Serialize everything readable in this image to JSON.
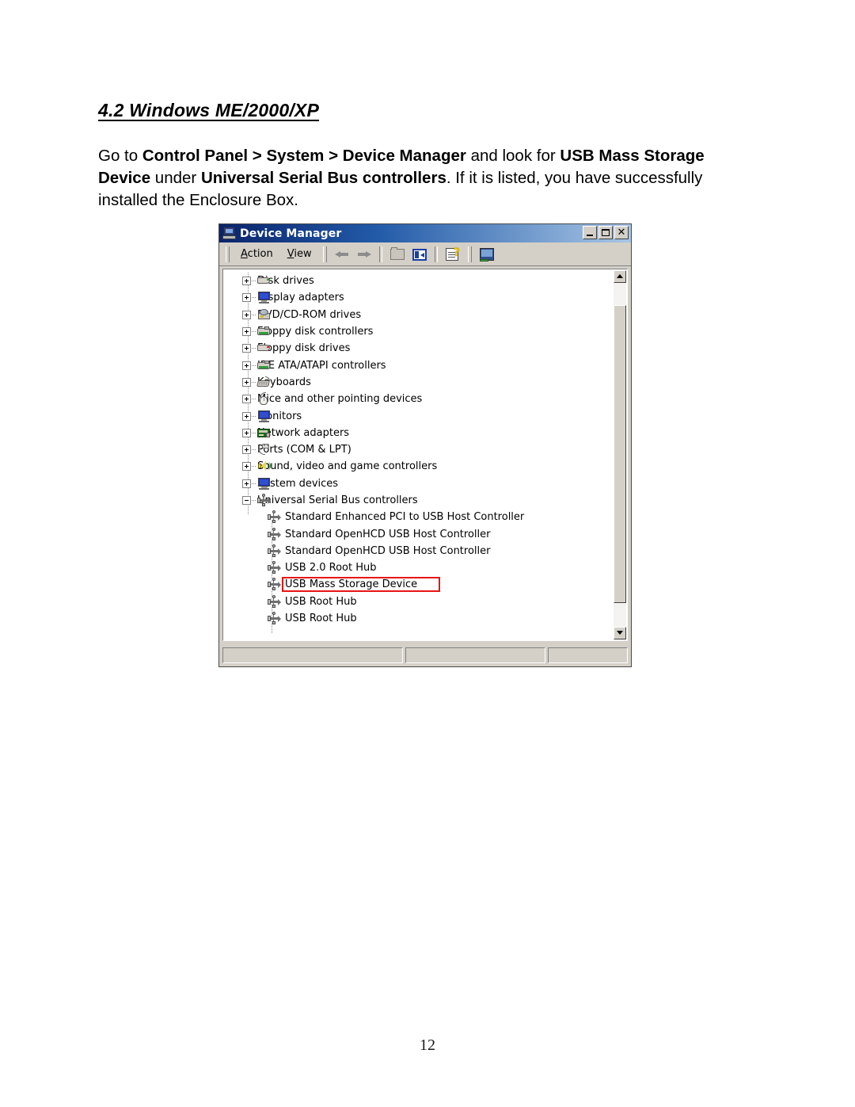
{
  "document": {
    "heading": "4.2 Windows ME/2000/XP",
    "paragraph": {
      "seg1": "Go to ",
      "b1": "Control Panel > System > Device Manager",
      "seg2": " and look for ",
      "b2": "USB Mass Storage Device",
      "seg3": " under ",
      "b3": "Universal Serial Bus controllers",
      "seg4": ". If it is listed, you have successfully installed the Enclosure Box."
    },
    "page_number": "12"
  },
  "window": {
    "title": "Device Manager",
    "title_icon": "computer-icon",
    "controls": {
      "minimize": "minimize-button",
      "maximize": "maximize-button",
      "close": "close-button"
    },
    "toolbar": {
      "menus": [
        {
          "label": "Action",
          "accel": "A"
        },
        {
          "label": "View",
          "accel": "V"
        }
      ],
      "icons": [
        "back-arrow-icon",
        "forward-arrow-icon",
        "show-hidden-devices-icon",
        "properties-icon",
        "help-icon",
        "scan-for-hardware-changes-icon"
      ]
    },
    "tree": {
      "root_items": [
        {
          "label": "Disk drives",
          "icon": "disk-drive-icon",
          "expanded": false
        },
        {
          "label": "Display adapters",
          "icon": "monitor-icon",
          "expanded": false
        },
        {
          "label": "DVD/CD-ROM drives",
          "icon": "dvd-drive-icon",
          "expanded": false
        },
        {
          "label": "Floppy disk controllers",
          "icon": "controller-card-icon",
          "expanded": false
        },
        {
          "label": "Floppy disk drives",
          "icon": "floppy-drive-icon",
          "expanded": false
        },
        {
          "label": "IDE ATA/ATAPI controllers",
          "icon": "controller-card-icon",
          "expanded": false
        },
        {
          "label": "Keyboards",
          "icon": "keyboard-icon",
          "expanded": false
        },
        {
          "label": "Mice and other pointing devices",
          "icon": "mouse-icon",
          "expanded": false
        },
        {
          "label": "Monitors",
          "icon": "monitor-icon",
          "expanded": false
        },
        {
          "label": "Network adapters",
          "icon": "network-card-icon",
          "expanded": false
        },
        {
          "label": "Ports (COM & LPT)",
          "icon": "port-plug-icon",
          "expanded": false
        },
        {
          "label": "Sound, video and game controllers",
          "icon": "speaker-icon",
          "expanded": false
        },
        {
          "label": "System devices",
          "icon": "monitor-icon",
          "expanded": false
        },
        {
          "label": "Universal Serial Bus controllers",
          "icon": "usb-icon",
          "expanded": true
        }
      ],
      "usb_children": [
        {
          "label": "Standard Enhanced PCI to USB Host Controller",
          "icon": "usb-icon",
          "highlighted": false
        },
        {
          "label": "Standard OpenHCD USB Host Controller",
          "icon": "usb-icon",
          "highlighted": false
        },
        {
          "label": "Standard OpenHCD USB Host Controller",
          "icon": "usb-icon",
          "highlighted": false
        },
        {
          "label": "USB 2.0 Root Hub",
          "icon": "usb-icon",
          "highlighted": false
        },
        {
          "label": "USB Mass Storage Device",
          "icon": "usb-icon",
          "highlighted": true
        },
        {
          "label": "USB Root Hub",
          "icon": "usb-icon",
          "highlighted": false
        },
        {
          "label": "USB Root Hub",
          "icon": "usb-icon",
          "highlighted": false
        }
      ],
      "highlight_color": "#e81414"
    },
    "statusbar": {
      "pane1": "",
      "pane2": "",
      "pane3": ""
    }
  }
}
